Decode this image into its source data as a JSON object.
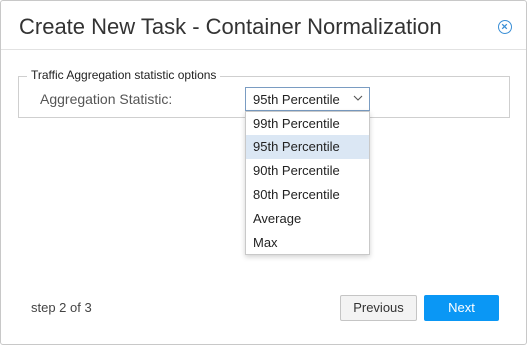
{
  "dialog": {
    "title": "Create New Task - Container Normalization",
    "close_icon": "close-circle-icon"
  },
  "section": {
    "legend": "Traffic Aggregation statistic options",
    "aggregation_label": "Aggregation Statistic:",
    "select": {
      "value": "95th Percentile",
      "icon": "chevron-down-icon",
      "options": [
        {
          "label": "99th Percentile",
          "selected": false
        },
        {
          "label": "95th Percentile",
          "selected": true
        },
        {
          "label": "90th Percentile",
          "selected": false
        },
        {
          "label": "80th Percentile",
          "selected": false
        },
        {
          "label": "Average",
          "selected": false
        },
        {
          "label": "Max",
          "selected": false
        }
      ]
    }
  },
  "footer": {
    "step": "step 2 of 3",
    "previous_label": "Previous",
    "next_label": "Next"
  },
  "colors": {
    "accent": "#0a97f5",
    "selected_option_bg": "#dbe7f4",
    "close_icon": "#3a8fd6"
  }
}
